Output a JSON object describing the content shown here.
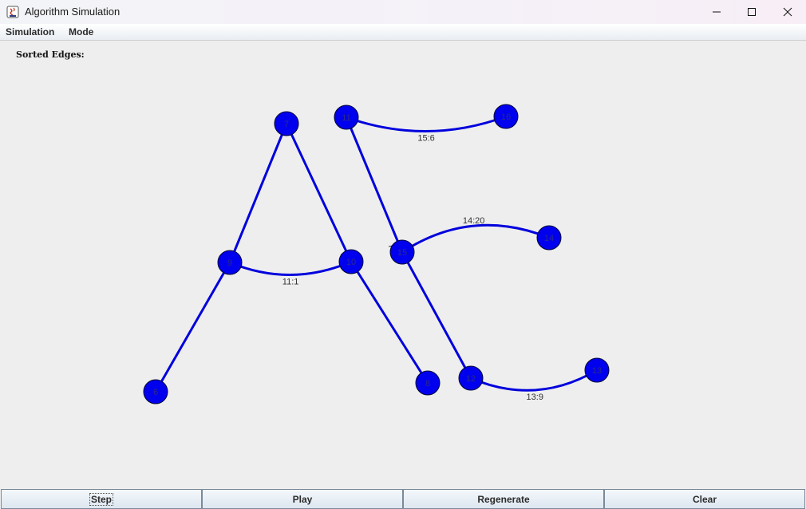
{
  "window": {
    "title": "Algorithm Simulation"
  },
  "menu": [
    {
      "label": "Simulation"
    },
    {
      "label": "Mode"
    }
  ],
  "panel": {
    "sorted_edges_label": "Sorted Edges:"
  },
  "colors": {
    "node_fill": "#0000ee",
    "edge": "#0000dd",
    "node_label": "#2a2a8a"
  },
  "graph": {
    "nodes": [
      {
        "id": "7",
        "label": "7"
      },
      {
        "id": "9",
        "label": "9"
      },
      {
        "id": "10",
        "label": "10"
      },
      {
        "id": "6",
        "label": "6"
      },
      {
        "id": "8",
        "label": "8"
      },
      {
        "id": "11",
        "label": "11"
      },
      {
        "id": "16",
        "label": "16"
      },
      {
        "id": "15",
        "label": "15"
      },
      {
        "id": "14",
        "label": "14"
      },
      {
        "id": "12",
        "label": "12"
      },
      {
        "id": "13",
        "label": "13"
      }
    ],
    "edges": [
      {
        "from": "7",
        "to": "9",
        "label": ""
      },
      {
        "from": "7",
        "to": "10",
        "label": ""
      },
      {
        "from": "9",
        "to": "10",
        "label": "11:1"
      },
      {
        "from": "9",
        "to": "6",
        "label": ""
      },
      {
        "from": "10",
        "to": "8",
        "label": ""
      },
      {
        "from": "11",
        "to": "16",
        "label": "15:6"
      },
      {
        "from": "11",
        "to": "15",
        "label": ""
      },
      {
        "from": "15",
        "to": "14",
        "label": "14:20"
      },
      {
        "from": "15",
        "to": "12",
        "label": ""
      },
      {
        "from": "12",
        "to": "13",
        "label": "13:9"
      }
    ]
  },
  "buttons": [
    {
      "label": "Step"
    },
    {
      "label": "Play"
    },
    {
      "label": "Regenerate"
    },
    {
      "label": "Clear"
    }
  ]
}
